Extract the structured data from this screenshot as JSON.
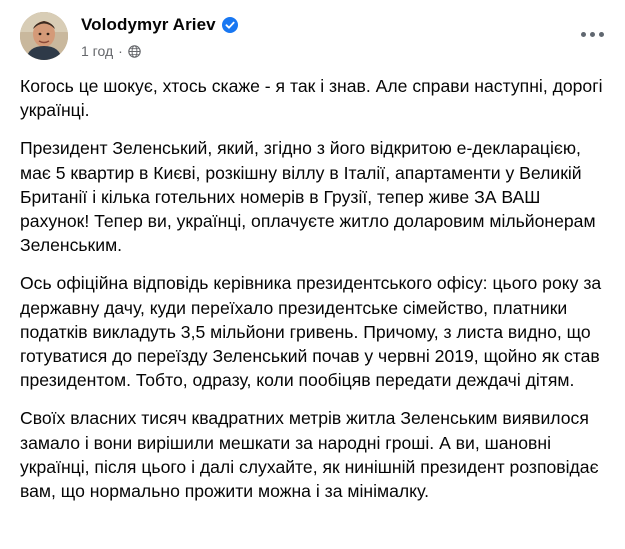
{
  "post": {
    "author": {
      "name": "Volodymyr Ariev",
      "verified_icon": "verified-badge-icon",
      "avatar_icon": "avatar"
    },
    "meta": {
      "time": "1 год",
      "separator": "·",
      "audience_icon": "globe-icon"
    },
    "more_icon": "more-options-icon",
    "paragraphs": [
      "Когось це шокує, хтось скаже - я так і знав. Але справи наступні, дорогі українці.",
      "Президент Зеленський, який, згідно з його відкритою е-декларацією, має 5 квартир в Києві, розкішну віллу в Італії, апартаменти у Великій Британії і кілька готельних номерів в Грузії, тепер живе ЗА ВАШ рахунок! Тепер ви, українці, оплачуєте житло доларовим мільйонерам Зеленським.",
      "Ось офіційна відповідь керівника президентського офісу: цього року за державну дачу, куди переїхало президентське сімейство, платники податків викладуть 3,5 мільйони гривень. Причому, з листа видно, що готуватися до переїзду Зеленський почав у червні 2019, щойно як став президентом. Тобто, одразу, коли пообіцяв передати деждачі дітям.",
      "Своїх власних тисяч квадратних метрів житла Зеленським виявилося замало і вони вирішили мешкати за народні гроші. А ви, шановні українці, після цього і далі слухайте, як нинішній президент розповідає вам, що нормально прожити можна і за мінімалку."
    ],
    "colors": {
      "verified": "#1877f2",
      "meta_text": "#65676b",
      "body_text": "#050505"
    }
  }
}
